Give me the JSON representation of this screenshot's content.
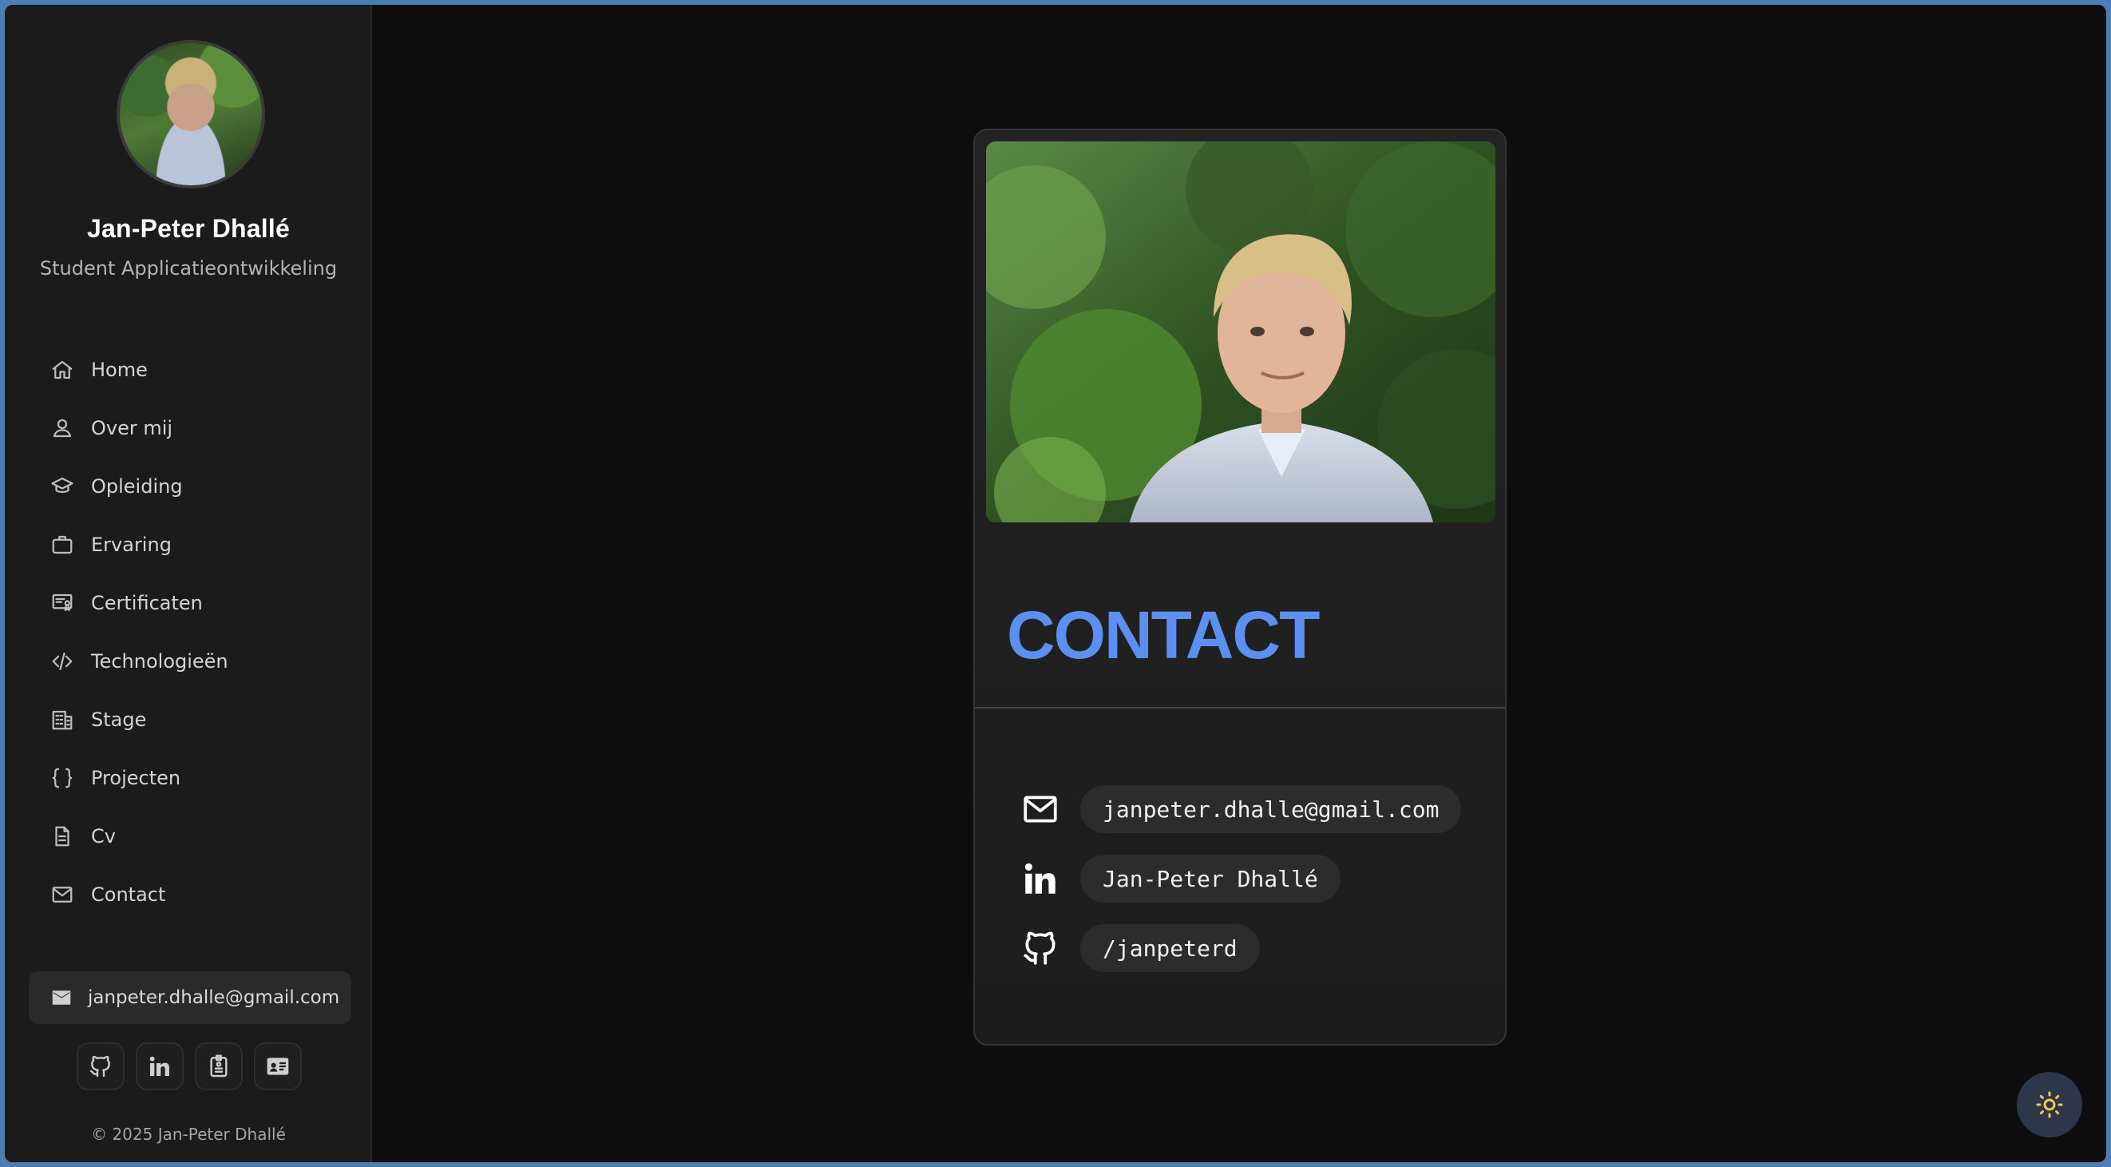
{
  "profile": {
    "name": "Jan-Peter Dhallé",
    "role": "Student Applicatieontwikkeling"
  },
  "nav": {
    "items": [
      {
        "label": "Home",
        "icon": "home-icon"
      },
      {
        "label": "Over mij",
        "icon": "user-icon"
      },
      {
        "label": "Opleiding",
        "icon": "graduation-cap-icon"
      },
      {
        "label": "Ervaring",
        "icon": "briefcase-icon"
      },
      {
        "label": "Certificaten",
        "icon": "certificate-icon"
      },
      {
        "label": "Technologieën",
        "icon": "code-icon"
      },
      {
        "label": "Stage",
        "icon": "building-icon"
      },
      {
        "label": "Projecten",
        "icon": "braces-icon"
      },
      {
        "label": "Cv",
        "icon": "document-icon"
      },
      {
        "label": "Contact",
        "icon": "mail-icon"
      }
    ]
  },
  "sidebar_footer": {
    "email": "janpeter.dhalle@gmail.com",
    "socials": [
      "github-icon",
      "linkedin-icon",
      "badge-icon",
      "id-card-icon"
    ],
    "copyright": "© 2025 Jan-Peter Dhallé"
  },
  "contact_card": {
    "title": "CONTACT",
    "items": [
      {
        "icon": "mail-icon",
        "value": "janpeter.dhalle@gmail.com"
      },
      {
        "icon": "linkedin-icon",
        "value": "Jan-Peter Dhallé"
      },
      {
        "icon": "github-icon",
        "value": "/janpeterd"
      }
    ]
  },
  "theme_toggle": {
    "icon": "sun-icon"
  },
  "colors": {
    "accent": "#5b8ff0",
    "background": "#0e0e0e",
    "sidebar": "#1b1b1b",
    "sun": "#f2c94c"
  }
}
